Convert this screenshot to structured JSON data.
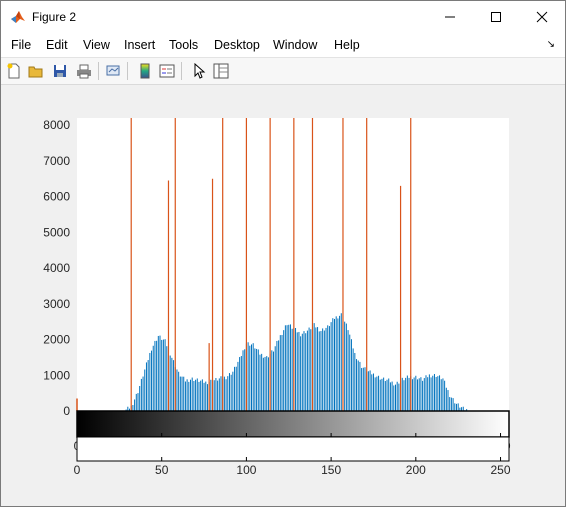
{
  "window": {
    "title": "Figure 2"
  },
  "menu": [
    "File",
    "Edit",
    "View",
    "Insert",
    "Tools",
    "Desktop",
    "Window",
    "Help"
  ],
  "toolbar": {
    "icons": [
      "new-figure-icon",
      "open-file-icon",
      "save-icon",
      "print-icon",
      "link-plot-icon",
      "colorbar-icon",
      "legend-icon",
      "edit-plot-arrow-icon",
      "property-inspector-icon"
    ]
  },
  "chart_data": {
    "type": "bar",
    "title": "",
    "xlabel": "",
    "ylabel": "",
    "xlim": [
      0,
      255
    ],
    "ylim": [
      0,
      8200
    ],
    "yticks": [
      0,
      1000,
      2000,
      3000,
      4000,
      5000,
      6000,
      7000,
      8000
    ],
    "xticks": [
      0,
      50,
      100,
      150,
      200,
      250
    ],
    "grid": false,
    "histogram_profile": {
      "description_units": "pixel intensity bins 0-255, counts",
      "x": [
        0,
        28,
        32,
        36,
        40,
        44,
        48,
        52,
        56,
        60,
        64,
        68,
        72,
        76,
        80,
        84,
        88,
        92,
        96,
        100,
        104,
        108,
        112,
        116,
        120,
        124,
        128,
        132,
        136,
        140,
        144,
        148,
        152,
        156,
        160,
        164,
        168,
        172,
        176,
        180,
        184,
        188,
        192,
        196,
        200,
        204,
        208,
        212,
        216,
        220,
        224,
        228,
        232
      ],
      "y": [
        0,
        0,
        120,
        550,
        1150,
        1750,
        2100,
        1950,
        1500,
        1050,
        850,
        900,
        850,
        800,
        850,
        900,
        950,
        1100,
        1450,
        1900,
        1850,
        1600,
        1500,
        1700,
        2100,
        2450,
        2300,
        2150,
        2250,
        2400,
        2250,
        2350,
        2600,
        2700,
        2300,
        1600,
        1250,
        1100,
        1000,
        900,
        850,
        750,
        880,
        950,
        950,
        880,
        1000,
        1000,
        900,
        450,
        200,
        60,
        0
      ]
    },
    "spikes": [
      {
        "x": 32,
        "y": 8200
      },
      {
        "x": 54,
        "y": 6450
      },
      {
        "x": 58,
        "y": 8200
      },
      {
        "x": 78,
        "y": 1900
      },
      {
        "x": 80,
        "y": 6500
      },
      {
        "x": 86,
        "y": 8200
      },
      {
        "x": 100,
        "y": 8200
      },
      {
        "x": 114,
        "y": 8200
      },
      {
        "x": 128,
        "y": 8200
      },
      {
        "x": 139,
        "y": 8200
      },
      {
        "x": 157,
        "y": 8200
      },
      {
        "x": 171,
        "y": 8200
      },
      {
        "x": 191,
        "y": 6300
      },
      {
        "x": 197,
        "y": 8200
      }
    ],
    "colors": {
      "bars": "#0072bd",
      "spikes": "#d95319"
    },
    "colorbar": {
      "from": "#000000",
      "to": "#ffffff",
      "xticks": [
        0,
        50,
        100,
        150,
        200,
        250
      ]
    }
  }
}
